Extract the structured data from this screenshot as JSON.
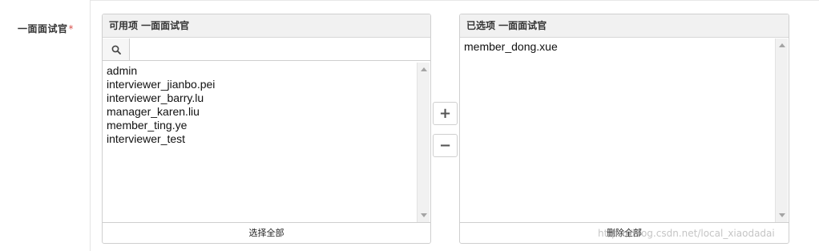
{
  "field": {
    "label": "一面面试官",
    "required_mark": "*"
  },
  "available": {
    "header": "可用项 一面面试官",
    "search_placeholder": "",
    "items": [
      "admin",
      "interviewer_jianbo.pei",
      "interviewer_barry.lu",
      "manager_karen.liu",
      "member_ting.ye",
      "interviewer_test"
    ],
    "select_all_label": "选择全部"
  },
  "selected": {
    "header": "已选项 一面面试官",
    "items": [
      "member_dong.xue"
    ],
    "remove_all_label": "删除全部"
  },
  "controls": {
    "add_label": "+",
    "remove_label": "−"
  },
  "watermark": "https://blog.csdn.net/local_xiaodadai",
  "icons": {
    "search": "search-icon"
  }
}
